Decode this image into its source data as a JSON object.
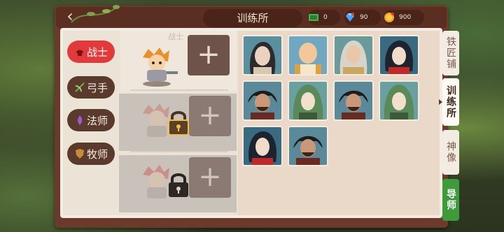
{
  "header": {
    "title": "训练所"
  },
  "currencies": {
    "cash": "0",
    "gems": "90",
    "gold": "900"
  },
  "classes": [
    {
      "label": "战士"
    },
    {
      "label": "弓手"
    },
    {
      "label": "法师"
    },
    {
      "label": "牧师"
    }
  ],
  "slots": {
    "top_label": "战士",
    "add_symbol": "+"
  },
  "side_tabs": [
    {
      "label": "铁匠铺"
    },
    {
      "label": "训练所"
    },
    {
      "label": "神像"
    },
    {
      "label": "导师"
    }
  ],
  "colors": {
    "accent": "#e23a3a",
    "guide": "#3f9a3a",
    "frame": "#6b3a2a"
  }
}
